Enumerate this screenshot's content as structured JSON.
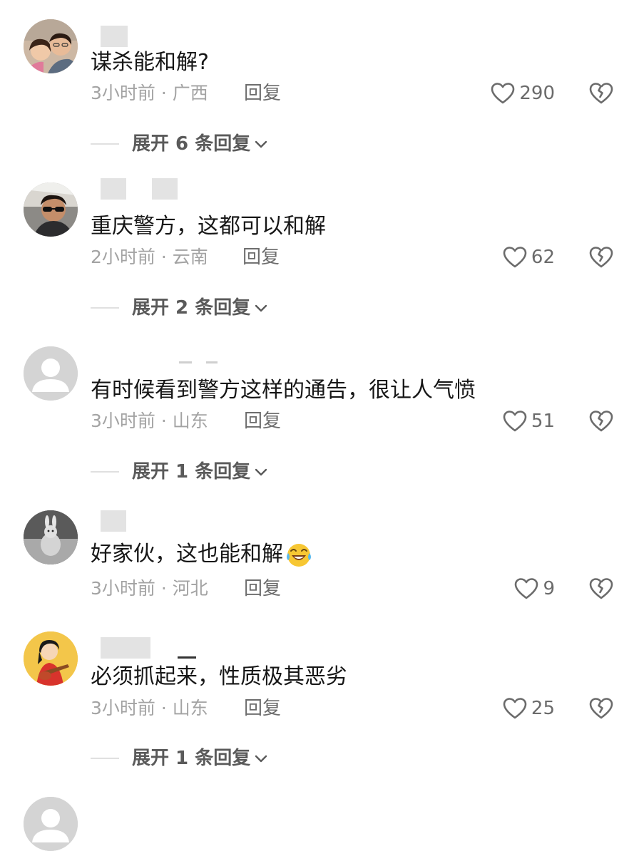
{
  "comments": [
    {
      "text": "谋杀能和解?",
      "time": "3小时前",
      "location": "广西",
      "meta": "3小时前 · 广西",
      "reply_label": "回复",
      "likes": "290",
      "expand_label": "展开 6 条回复",
      "avatar_icon": "photo-avatar-couple"
    },
    {
      "text": "重庆警方，这都可以和解",
      "time": "2小时前",
      "location": "云南",
      "meta": "2小时前 · 云南",
      "reply_label": "回复",
      "likes": "62",
      "expand_label": "展开 2 条回复",
      "avatar_icon": "photo-avatar-sunglasses"
    },
    {
      "text": "有时候看到警方这样的通告，很让人气愤",
      "time": "3小时前",
      "location": "山东",
      "meta": "3小时前 · 山东",
      "reply_label": "回复",
      "likes": "51",
      "expand_label": "展开 1 条回复",
      "avatar_icon": "default-avatar"
    },
    {
      "text": "好家伙，这也能和解",
      "emoji": "crying-laughing-emoji",
      "time": "3小时前",
      "location": "河北",
      "meta": "3小时前 · 河北",
      "reply_label": "回复",
      "likes": "9",
      "avatar_icon": "photo-avatar-rabbit"
    },
    {
      "text": "必须抓起来，性质极其恶劣",
      "time": "3小时前",
      "location": "山东",
      "meta": "3小时前 · 山东",
      "reply_label": "回复",
      "likes": "25",
      "expand_label": "展开 1 条回复",
      "avatar_icon": "cartoon-avatar-guitarist"
    }
  ],
  "colors": {
    "text_primary": "#161616",
    "text_meta": "#a3a3a3",
    "icon_gray": "#6b6b6b",
    "redaction": "#e3e3e3"
  },
  "icons": {
    "like": "heart-outline-icon",
    "dislike": "broken-heart-icon",
    "expand": "chevron-down-icon"
  }
}
